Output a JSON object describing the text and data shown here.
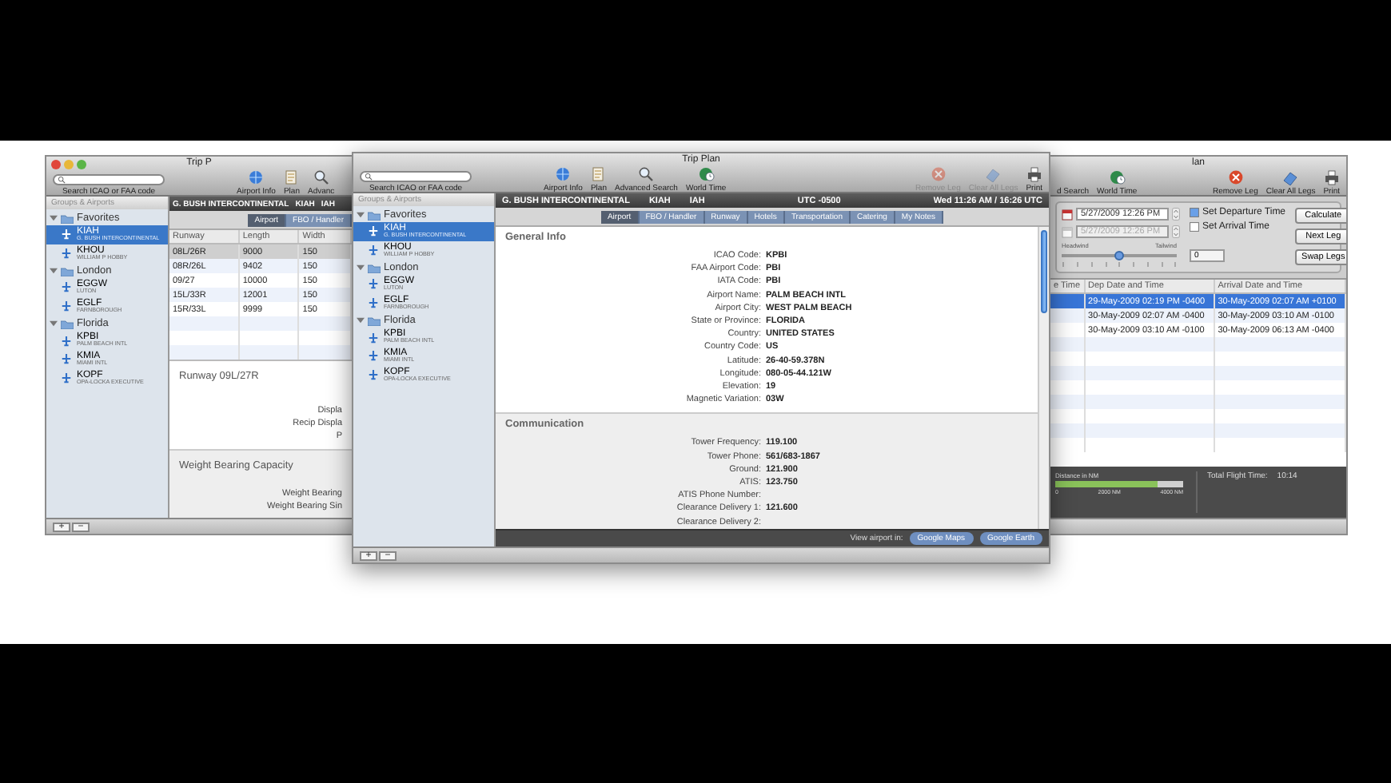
{
  "left_window": {
    "title": "Trip P",
    "search": {
      "label": "Search ICAO or FAA code"
    },
    "toolbar": {
      "left": [
        {
          "label": "Airport Info",
          "kind": "globe",
          "disabled": false
        },
        {
          "label": "Plan",
          "kind": "document",
          "disabled": false
        },
        {
          "label": "Advanc",
          "kind": "search",
          "disabled": false
        }
      ]
    },
    "sidebar": {
      "header": "Groups & Airports",
      "groups": [
        {
          "name": "Favorites",
          "expanded": true,
          "children": [
            {
              "code": "KIAH",
              "name": "G. BUSH INTERCONTINENTAL",
              "selected": true
            },
            {
              "code": "KHOU",
              "name": "WILLIAM P HOBBY",
              "selected": false
            }
          ]
        },
        {
          "name": "London",
          "expanded": true,
          "children": [
            {
              "code": "EGGW",
              "name": "LUTON",
              "selected": false
            },
            {
              "code": "EGLF",
              "name": "FARNBOROUGH",
              "selected": false
            }
          ]
        },
        {
          "name": "Florida",
          "expanded": true,
          "children": [
            {
              "code": "KPBI",
              "name": "PALM BEACH INTL",
              "selected": false
            },
            {
              "code": "KMIA",
              "name": "MIAMI INTL",
              "selected": false
            },
            {
              "code": "KOPF",
              "name": "OPA-LOCKA EXECUTIVE",
              "selected": false
            }
          ]
        }
      ]
    },
    "header": {
      "airport": "G. BUSH INTERCONTINENTAL",
      "codes": [
        "KIAH",
        "IAH"
      ]
    },
    "tabs": [
      {
        "label": "Airport",
        "selected": true
      },
      {
        "label": "FBO / Handler",
        "selected": false
      }
    ],
    "runway_table": {
      "columns": [
        "Runway",
        "Length",
        "Width"
      ],
      "rows": [
        {
          "cells": [
            "08L/26R",
            "9000",
            "150"
          ],
          "selected": true
        },
        {
          "cells": [
            "08R/26L",
            "9402",
            "150"
          ],
          "selected": false
        },
        {
          "cells": [
            "09/27",
            "10000",
            "150"
          ],
          "selected": false
        },
        {
          "cells": [
            "15L/33R",
            "12001",
            "150"
          ],
          "selected": false
        },
        {
          "cells": [
            "15R/33L",
            "9999",
            "150"
          ],
          "selected": false
        }
      ]
    },
    "runway_detail": {
      "title": "Runway 09L/27R",
      "labels": [
        "Displa",
        "Recip Displa",
        "P"
      ]
    },
    "weight_section": {
      "title": "Weight Bearing Capacity",
      "labels": [
        "Weight Bearing",
        "Weight Bearing Sin"
      ]
    },
    "bottom_buttons": [
      "+",
      "−"
    ]
  },
  "main_window": {
    "title": "Trip Plan",
    "search": {
      "label": "Search ICAO or FAA code"
    },
    "toolbar": {
      "left": [
        {
          "label": "Airport Info",
          "kind": "globe",
          "disabled": false
        },
        {
          "label": "Plan",
          "kind": "document",
          "disabled": false
        },
        {
          "label": "Advanced Search",
          "kind": "search",
          "disabled": false
        },
        {
          "label": "World Time",
          "kind": "clock",
          "disabled": false
        }
      ],
      "right": [
        {
          "label": "Remove Leg",
          "kind": "remove",
          "disabled": true
        },
        {
          "label": "Clear All Legs",
          "kind": "clear",
          "disabled": true
        },
        {
          "label": "Print",
          "kind": "print",
          "disabled": false
        }
      ]
    },
    "sidebar": {
      "header": "Groups & Airports",
      "groups": [
        {
          "name": "Favorites",
          "expanded": true,
          "children": [
            {
              "code": "KIAH",
              "name": "G. BUSH INTERCONTINENTAL",
              "selected": true
            },
            {
              "code": "KHOU",
              "name": "WILLIAM P HOBBY",
              "selected": false
            }
          ]
        },
        {
          "name": "London",
          "expanded": true,
          "children": [
            {
              "code": "EGGW",
              "name": "LUTON",
              "selected": false
            },
            {
              "code": "EGLF",
              "name": "FARNBOROUGH",
              "selected": false
            }
          ]
        },
        {
          "name": "Florida",
          "expanded": true,
          "children": [
            {
              "code": "KPBI",
              "name": "PALM BEACH INTL",
              "selected": false
            },
            {
              "code": "KMIA",
              "name": "MIAMI INTL",
              "selected": false
            },
            {
              "code": "KOPF",
              "name": "OPA-LOCKA EXECUTIVE",
              "selected": false
            }
          ]
        }
      ]
    },
    "header": {
      "airport": "G. BUSH INTERCONTINENTAL",
      "codes": [
        "KIAH",
        "IAH"
      ],
      "utc": "UTC -0500",
      "time": "Wed 11:26 AM / 16:26 UTC"
    },
    "tabs": [
      {
        "label": "Airport",
        "selected": true
      },
      {
        "label": "FBO / Handler",
        "selected": false
      },
      {
        "label": "Runway",
        "selected": false
      },
      {
        "label": "Hotels",
        "selected": false
      },
      {
        "label": "Transportation",
        "selected": false
      },
      {
        "label": "Catering",
        "selected": false
      },
      {
        "label": "My Notes",
        "selected": false
      }
    ],
    "sections": [
      {
        "title": "General Info",
        "fields": [
          {
            "label": "ICAO Code:",
            "value": "KPBI"
          },
          {
            "label": "FAA Airport Code:",
            "value": "PBI"
          },
          {
            "label": "IATA Code:",
            "value": "PBI"
          },
          {
            "label": "Airport Name:",
            "value": "PALM BEACH INTL"
          },
          {
            "label": "Airport City:",
            "value": "WEST PALM BEACH"
          },
          {
            "label": "State or Province:",
            "value": "FLORIDA"
          },
          {
            "label": "Country:",
            "value": "UNITED STATES"
          },
          {
            "label": "Country Code:",
            "value": "US"
          },
          {
            "label": "Latitude:",
            "value": "26-40-59.378N"
          },
          {
            "label": "Longitude:",
            "value": "080-05-44.121W"
          },
          {
            "label": "Elevation:",
            "value": "19"
          },
          {
            "label": "Magnetic Variation:",
            "value": "03W"
          }
        ]
      },
      {
        "title": "Communication",
        "fields": [
          {
            "label": "Tower Frequency:",
            "value": "119.100"
          },
          {
            "label": "Tower Phone:",
            "value": "561/683-1867"
          },
          {
            "label": "Ground:",
            "value": "121.900"
          },
          {
            "label": "ATIS:",
            "value": "123.750"
          },
          {
            "label": "ATIS Phone Number:"
          },
          {
            "label": "Clearance Delivery 1:",
            "value": "121.600"
          },
          {
            "label": "Clearance Delivery 2:"
          }
        ]
      }
    ],
    "footer": {
      "label": "View airport in:",
      "buttons": [
        "Google Maps",
        "Google Earth"
      ]
    },
    "bottom_buttons": [
      "+",
      "−"
    ]
  },
  "right_window": {
    "title": "lan",
    "toolbar": {
      "left": [
        {
          "label": "d Search",
          "kind": "text",
          "disabled": false
        },
        {
          "label": "World Time",
          "kind": "clock",
          "disabled": false
        }
      ],
      "right": [
        {
          "label": "Remove Leg",
          "kind": "remove",
          "disabled": false
        },
        {
          "label": "Clear All Legs",
          "kind": "clear",
          "disabled": false
        },
        {
          "label": "Print",
          "kind": "print",
          "disabled": false
        }
      ]
    },
    "planner": {
      "dates": [
        {
          "value": "5/27/2009 12:26 PM",
          "disabled": false
        },
        {
          "value": "5/27/2009 12:26 PM",
          "disabled": true
        }
      ],
      "checks": [
        {
          "label": "Set Departure Time",
          "checked": true
        },
        {
          "label": "Set Arrival Time",
          "checked": false
        }
      ],
      "buttons": [
        "Calculate",
        "Next Leg",
        "Swap Legs"
      ],
      "wind": {
        "left": "Headwind",
        "right": "Tailwind",
        "level": 0.5
      },
      "wind_value": "0"
    },
    "legs_table": {
      "columns": [
        "e Time",
        "Dep Date and Time",
        "Arrival Date and Time"
      ],
      "rows": [
        {
          "departure": "29-May-2009 02:19 PM -0400",
          "arrival": "30-May-2009 02:07 AM +0100",
          "selected": true
        },
        {
          "departure": "30-May-2009 02:07 AM -0400",
          "arrival": "30-May-2009 03:10 AM -0100",
          "selected": false
        },
        {
          "departure": "30-May-2009 03:10 AM -0100",
          "arrival": "30-May-2009 06:13 AM -0400",
          "selected": false
        }
      ]
    },
    "summary": {
      "distance_label": "Distance in NM",
      "level": 0.8,
      "ticks": [
        "0",
        "2000 NM",
        "4000 NM"
      ],
      "total_label": "Total Flight Time:",
      "total_value": "10:14"
    }
  }
}
